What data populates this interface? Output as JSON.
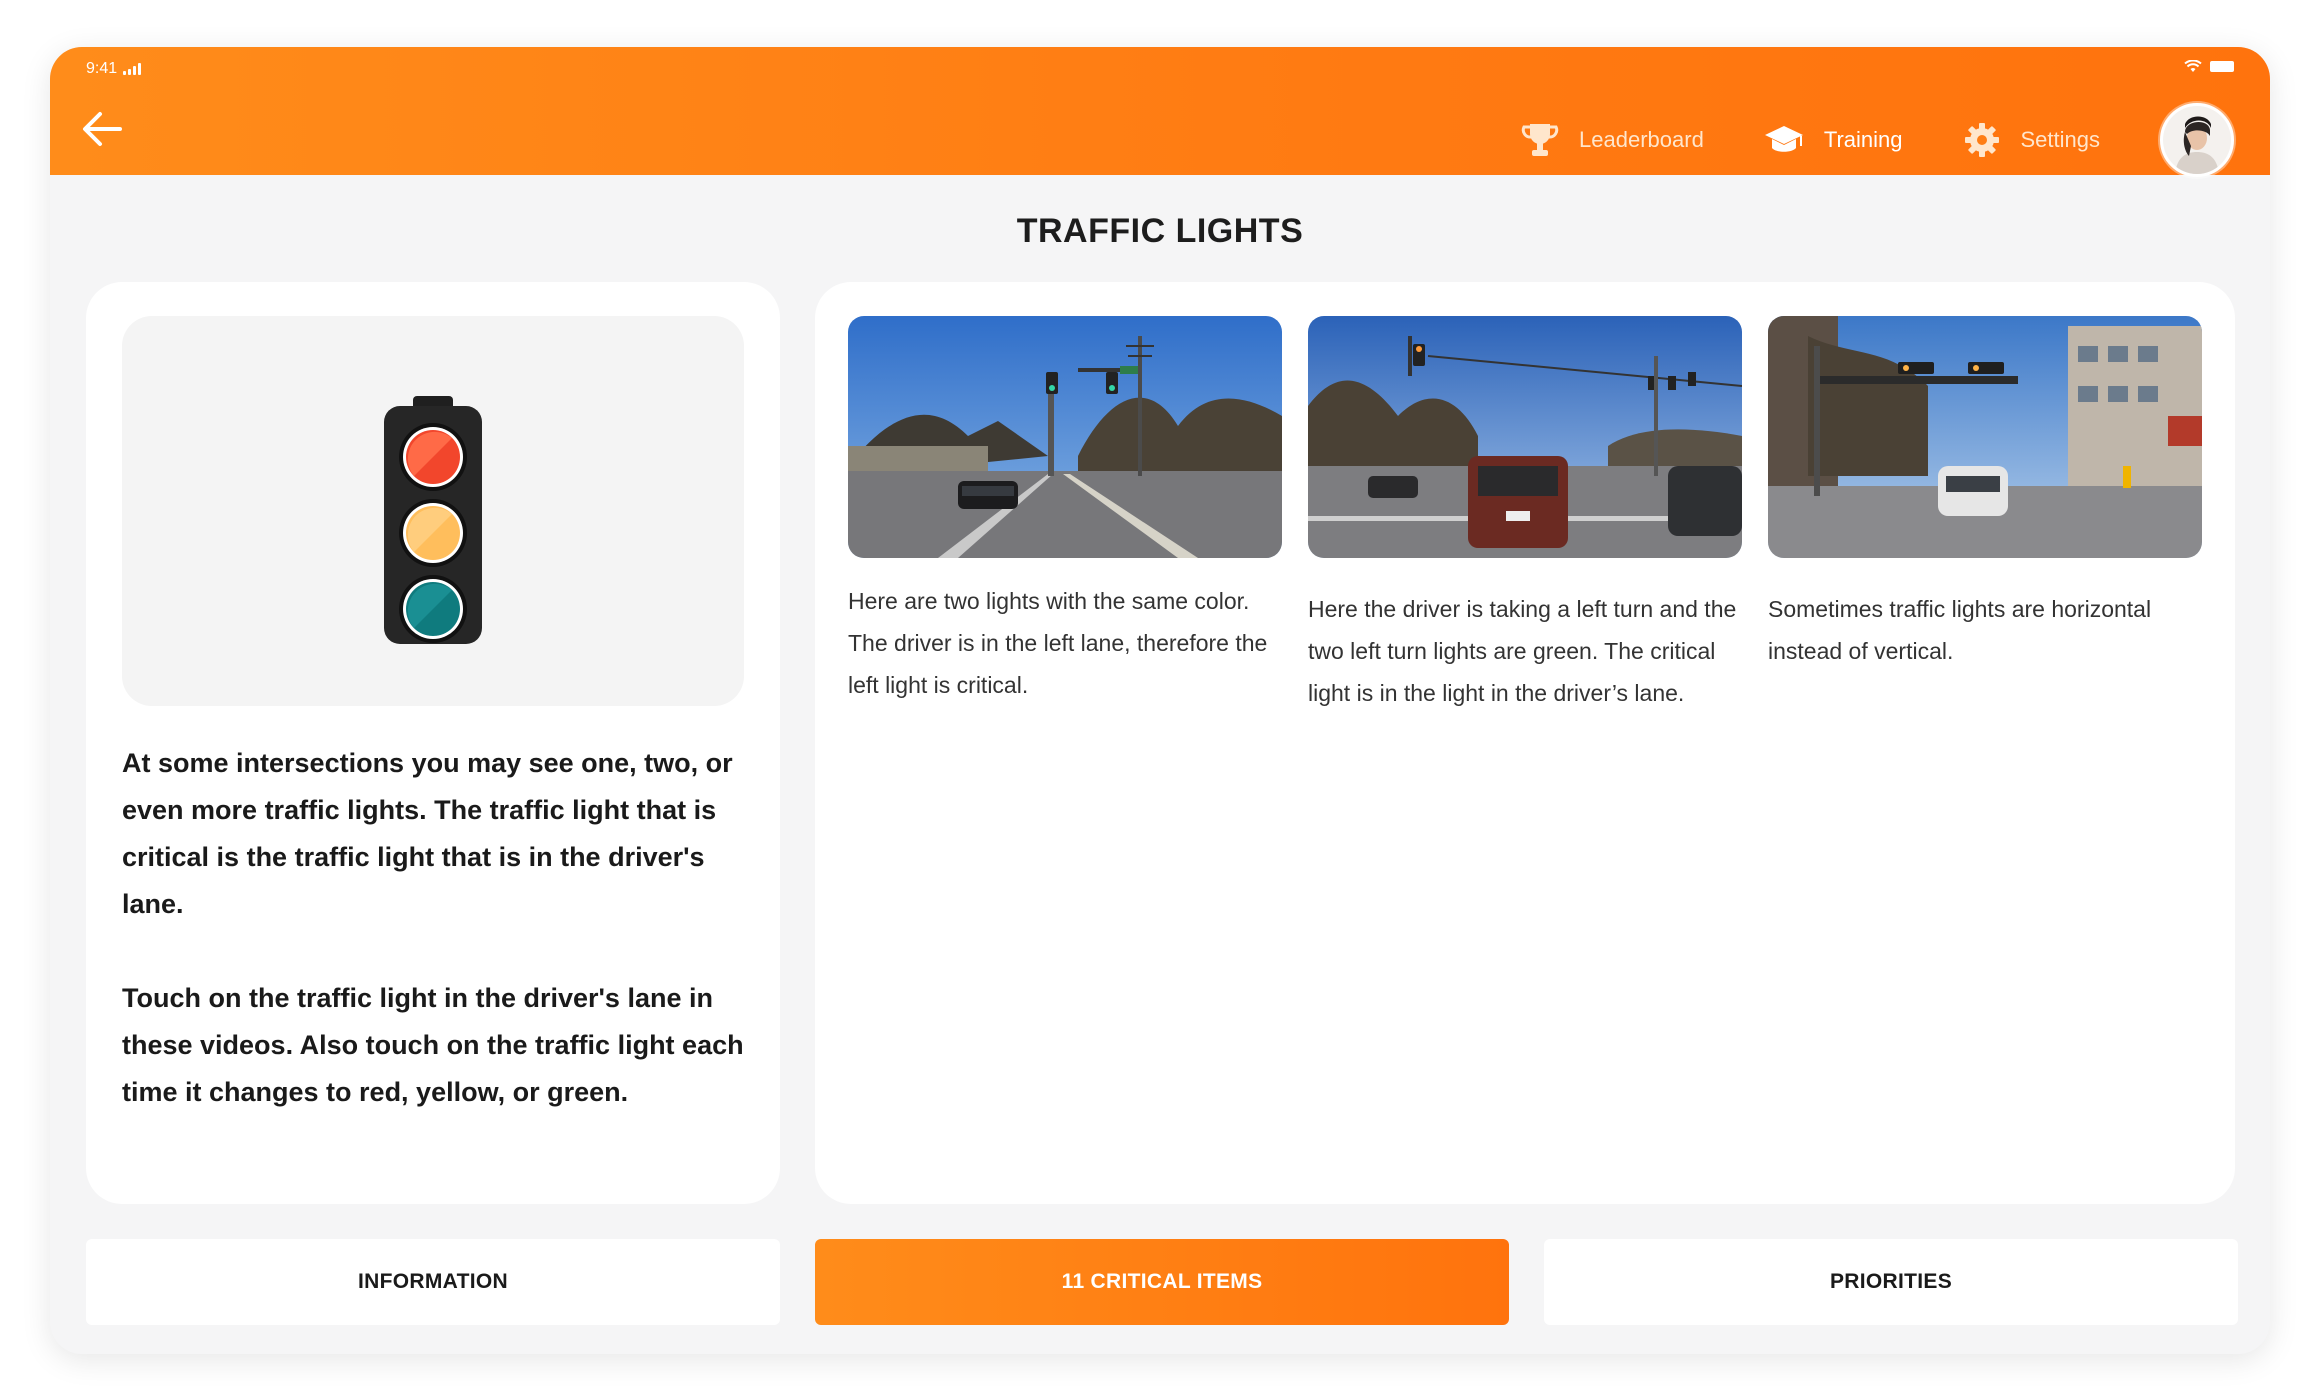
{
  "status_bar": {
    "time": "9:41"
  },
  "nav": {
    "back_label": "Back",
    "items": [
      {
        "label": "Leaderboard",
        "icon": "trophy-icon",
        "active": false
      },
      {
        "label": "Training",
        "icon": "graduation-cap-icon",
        "active": true
      },
      {
        "label": "Settings",
        "icon": "gear-icon",
        "active": false
      }
    ]
  },
  "page": {
    "title": "TRAFFIC LIGHTS"
  },
  "intro": {
    "paragraph_1": "At some intersections you may see one, two, or even more traffic lights.  The traffic light that is critical is the traffic light that is in the driver's lane.",
    "paragraph_2": "Touch on the traffic light in the driver's lane in these videos. Also touch on the traffic light each time it changes to red, yellow, or green."
  },
  "examples": [
    {
      "caption": "Here are two lights with the same color. The driver is in the left lane, therefore the left light is critical."
    },
    {
      "caption": "Here the driver is taking a left turn and the two left turn lights are green. The critical light is in the light in the driver’s lane."
    },
    {
      "caption": "Sometimes traffic lights are horizontal instead of vertical."
    }
  ],
  "tabs": [
    {
      "label": "INFORMATION",
      "active": false
    },
    {
      "label": "11 CRITICAL ITEMS",
      "active": true
    },
    {
      "label": "PRIORITIES",
      "active": false
    }
  ],
  "colors": {
    "accent": "#ff7a12",
    "light_red": "#f2462c",
    "light_yellow": "#ffbe5c",
    "light_green": "#0f7b7e"
  }
}
